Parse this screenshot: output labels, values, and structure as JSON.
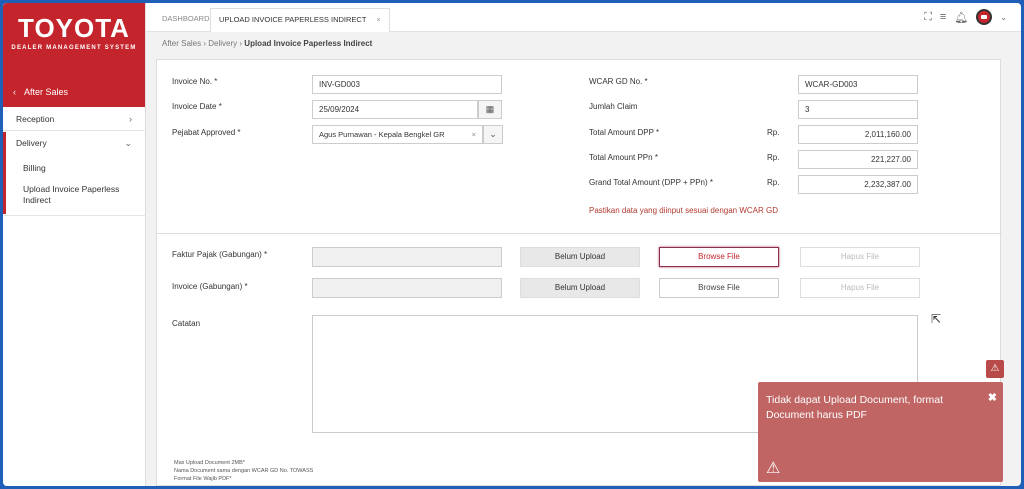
{
  "brand": {
    "name": "TOYOTA",
    "subtitle": "DEALER MANAGEMENT SYSTEM",
    "back_label": "After Sales"
  },
  "sidebar": {
    "items": [
      {
        "label": "Reception"
      },
      {
        "label": "Delivery"
      },
      {
        "label": "Billing"
      },
      {
        "label": "Upload Invoice Paperless Indirect"
      }
    ]
  },
  "tabs": [
    {
      "label": "DASHBOARD"
    },
    {
      "label": "UPLOAD INVOICE PAPERLESS INDIRECT"
    }
  ],
  "breadcrumb": {
    "a": "After Sales",
    "b": "Delivery",
    "c": "Upload Invoice Paperless Indirect"
  },
  "form": {
    "invoice_no": {
      "label": "Invoice No. *",
      "value": "INV-GD003"
    },
    "invoice_date": {
      "label": "Invoice Date *",
      "value": "25/09/2024"
    },
    "pejabat": {
      "label": "Pejabat Approved *",
      "value": "Agus Purnawan - Kepala Bengkel GR"
    },
    "wcar": {
      "label": "WCAR GD No. *",
      "value": "WCAR-GD003"
    },
    "jumlah": {
      "label": "Jumlah Claim",
      "value": "3"
    },
    "dpp": {
      "label": "Total Amount DPP *",
      "currency": "Rp.",
      "value": "2,011,160.00"
    },
    "ppn": {
      "label": "Total Amount PPn *",
      "currency": "Rp.",
      "value": "221,227.00"
    },
    "grand": {
      "label": "Grand Total Amount (DPP + PPn) *",
      "currency": "Rp.",
      "value": "2,232,387.00"
    },
    "warning": "Pastikan data yang diinput sesuai dengan WCAR GD"
  },
  "uploads": {
    "faktur": {
      "label": "Faktur Pajak (Gabungan) *",
      "status": "Belum Upload",
      "browse": "Browse File",
      "delete": "Hapus File"
    },
    "invoice": {
      "label": "Invoice (Gabungan) *",
      "status": "Belum Upload",
      "browse": "Browse File",
      "delete": "Hapus File"
    },
    "catatan_label": "Catatan"
  },
  "notes": {
    "line1": "Max Upload Document 2MB*",
    "line2": "Nama Document sama dengan WCAR GD No. TOWASS",
    "line3": "Format File Wajib PDF*"
  },
  "toast": {
    "message": "Tidak dapat Upload Document, format Document harus PDF",
    "close": "✖"
  },
  "colors": {
    "brand_red": "#c4252c",
    "toast_bg": "#c06464"
  }
}
